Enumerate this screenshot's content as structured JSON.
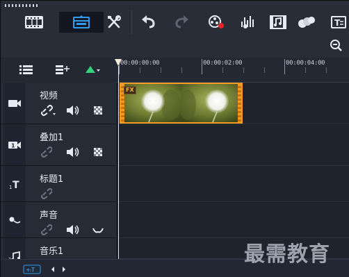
{
  "toolbar": {
    "buttons": [
      {
        "id": "storyboard-view",
        "icon": "film-strip-icon"
      },
      {
        "id": "timeline-view",
        "icon": "timeline-icon",
        "active": true
      },
      {
        "id": "tools",
        "icon": "tools-icon"
      },
      {
        "id": "undo",
        "icon": "undo-icon"
      },
      {
        "id": "redo",
        "icon": "redo-icon"
      },
      {
        "id": "record-capture",
        "icon": "record-icon"
      },
      {
        "id": "audio-mixer",
        "icon": "audio-mixer-icon"
      },
      {
        "id": "auto-music",
        "icon": "auto-music-icon"
      },
      {
        "id": "motion-tracking",
        "icon": "circles-icon"
      },
      {
        "id": "subtitle-editor",
        "icon": "subtitle-icon"
      }
    ],
    "zoom_icon": "zoom-out-icon"
  },
  "ruler": {
    "labels": [
      "00:00:00:00",
      "00:00:02:00",
      "00:00:04:00"
    ]
  },
  "tracks": [
    {
      "name": "视频",
      "icon": "video-track-icon",
      "controls": [
        "link-icon",
        "volume-icon",
        "checker-icon"
      ]
    },
    {
      "name": "叠加1",
      "icon": "overlay-track-icon",
      "controls": [
        "link-icon",
        "volume-icon",
        "checker-icon"
      ]
    },
    {
      "name": "标题1",
      "icon": "title-track-icon",
      "controls": [
        "link-icon"
      ]
    },
    {
      "name": "声音",
      "icon": "voice-track-icon",
      "controls": [
        "link-icon",
        "volume-icon",
        "wave-icon"
      ]
    },
    {
      "name": "音乐1",
      "icon": "music-track-icon",
      "controls": [
        "link-icon",
        "volume-icon",
        "wave-icon"
      ]
    }
  ],
  "clip": {
    "badge": "FX",
    "thumbnail": "dandelion"
  },
  "bottom": {
    "add_track_label": "+ᵢT"
  },
  "watermark": "最需教育",
  "colors": {
    "accent": "#2f9df4",
    "clip_border": "#f39a23",
    "play_green": "#34d27a"
  }
}
